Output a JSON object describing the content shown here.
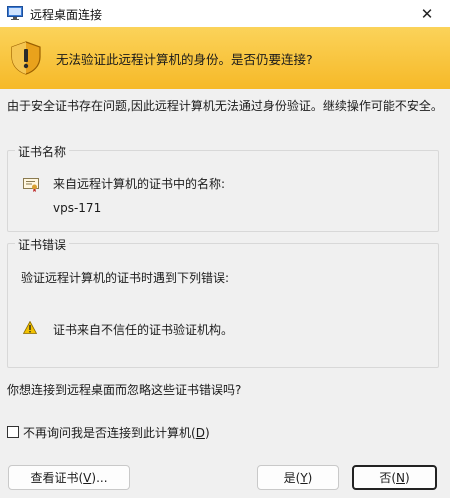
{
  "window": {
    "title": "远程桌面连接"
  },
  "warning": {
    "text": "无法验证此远程计算机的身份。是否仍要连接?"
  },
  "intro": "由于安全证书存在问题,因此远程计算机无法通过身份验证。继续操作可能不安全。",
  "cert_group": {
    "legend": "证书名称",
    "line1": "来自远程计算机的证书中的名称:",
    "name": "vps-171"
  },
  "error_group": {
    "legend": "证书错误",
    "line1": "验证远程计算机的证书时遇到下列错误:",
    "error": "证书来自不信任的证书验证机构。"
  },
  "question": "你想连接到远程桌面而忽略这些证书错误吗?",
  "checkbox": {
    "label_prefix": "不再询问我是否连接到此计算机(",
    "accel": "D",
    "label_suffix": ")",
    "checked": false
  },
  "buttons": {
    "view": {
      "prefix": "查看证书(",
      "accel": "V",
      "suffix": ")..."
    },
    "yes": {
      "prefix": "是(",
      "accel": "Y",
      "suffix": ")"
    },
    "no": {
      "prefix": "否(",
      "accel": "N",
      "suffix": ")"
    }
  },
  "colors": {
    "banner": "#f8c23a",
    "background": "#f0f0f0"
  },
  "icons": [
    "remote-desktop-icon",
    "close-icon",
    "security-shield-warning-icon",
    "certificate-icon",
    "warning-icon"
  ]
}
